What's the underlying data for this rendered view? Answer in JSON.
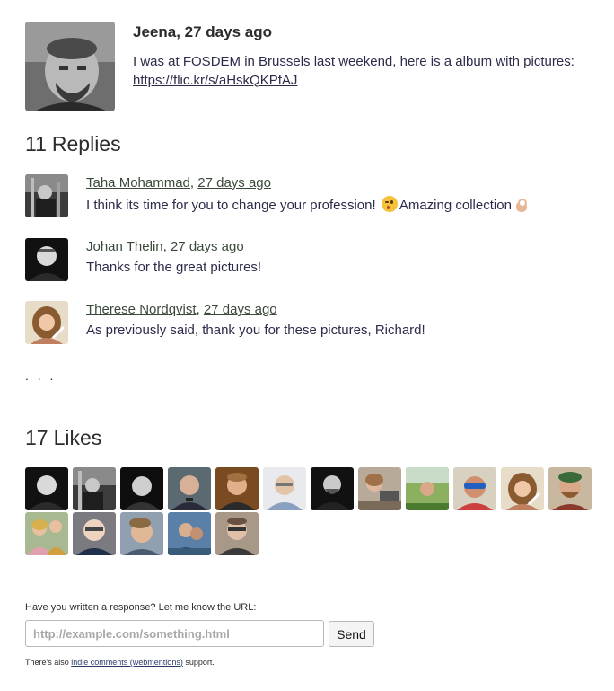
{
  "post": {
    "author": "Jeena",
    "time": "27 days ago",
    "text": "I was at FOSDEM in Brussels last weekend, here is a album with pictures:",
    "link": "https://flic.kr/s/aHskQKPfAJ"
  },
  "replies": {
    "count": "11",
    "label": "Replies",
    "items": [
      {
        "author": "Taha Mohammad",
        "time": "27 days ago",
        "text_before": "I think its time for you to change your profession!",
        "text_after": "Amazing collection",
        "emojis": [
          "winking-face-emoji",
          "ok-hand-emoji"
        ]
      },
      {
        "author": "Johan Thelin",
        "time": "27 days ago",
        "text": "Thanks for the great pictures!"
      },
      {
        "author": "Therese Nordqvist",
        "time": "27 days ago",
        "text": "As previously said, thank you for these pictures, Richard!"
      }
    ],
    "more": ". . ."
  },
  "likes": {
    "count": "17",
    "label": "Likes"
  },
  "response_form": {
    "label": "Have you written a response? Let me know the URL:",
    "placeholder": "http://example.com/something.html",
    "send_label": "Send",
    "footnote_before": "There's also",
    "footnote_link": "indie comments (webmentions)",
    "footnote_after": "support."
  },
  "colors": {
    "text": "#2c2c4a",
    "heading": "#2c2c2c",
    "link": "#3a4a3a",
    "input_border": "#b8b8b8",
    "button_bg": "#f4f4f4"
  }
}
